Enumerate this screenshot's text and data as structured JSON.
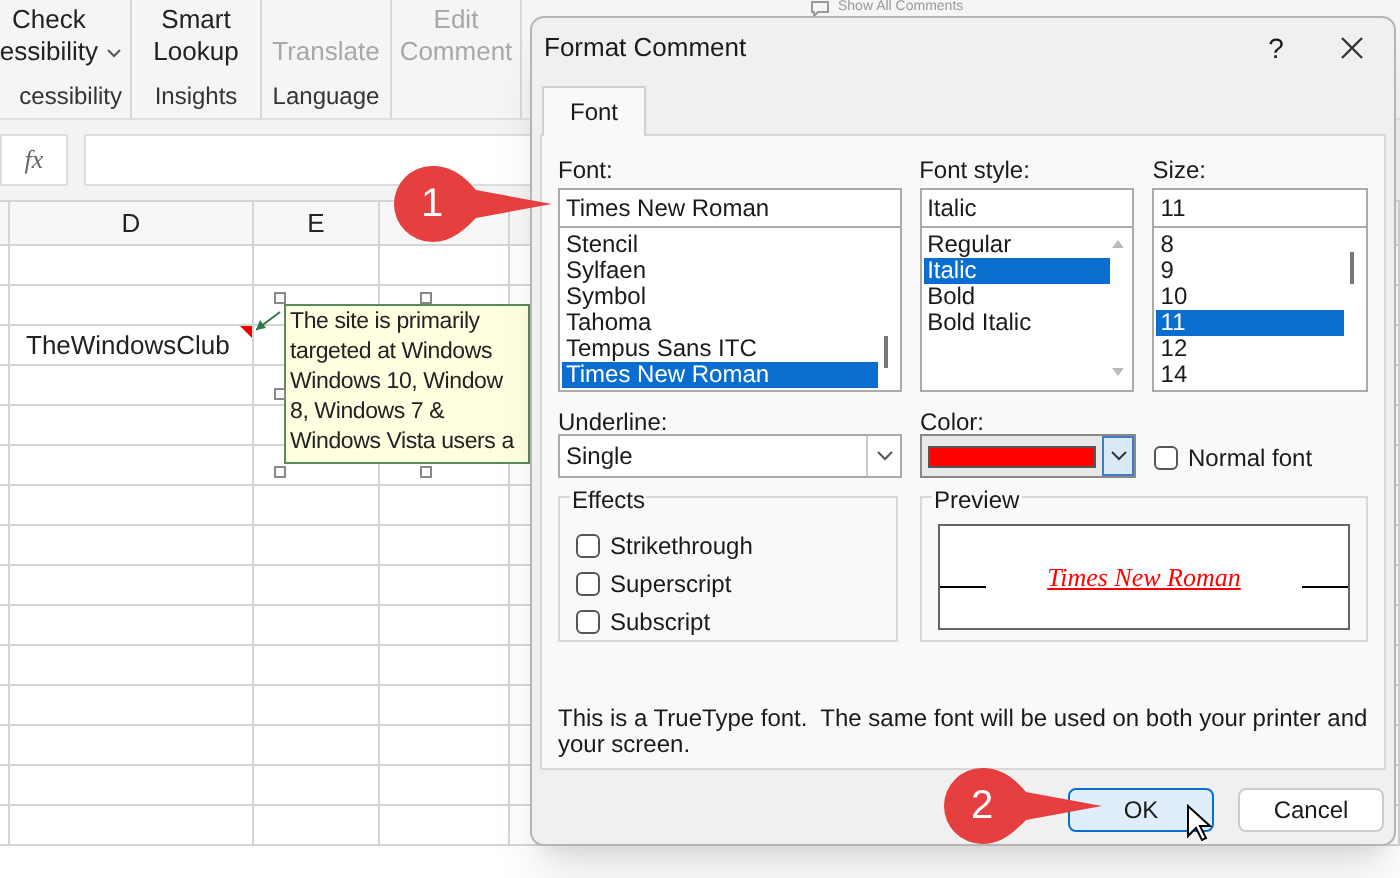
{
  "ribbon": {
    "top_label": "Show All Comments",
    "groups": [
      {
        "button": "Check\nessibility",
        "dropdown": true,
        "label": "cessibility",
        "disabled": false
      },
      {
        "button": "Smart\nLookup",
        "dropdown": false,
        "label": "Insights",
        "disabled": false
      },
      {
        "button": "Translate",
        "dropdown": false,
        "label": "Language",
        "disabled": true
      },
      {
        "button": "Edit\nComment",
        "dropdown": false,
        "disabled": true
      }
    ]
  },
  "formula_bar": {
    "fx": "fx"
  },
  "sheet": {
    "columns": [
      "D",
      "E"
    ],
    "cell_text": "TheWindowsClub",
    "comment": [
      "The site is primarily",
      "targeted at Windows",
      "Windows 10, Window",
      "8, Windows 7 &",
      "Windows Vista users a"
    ]
  },
  "dialog": {
    "title": "Format Comment",
    "help": "?",
    "tabs": [
      {
        "label": "Font",
        "selected": true
      }
    ],
    "font": {
      "label": "Font:",
      "value": "Times New Roman",
      "items": [
        {
          "label": "Stencil",
          "selected": false
        },
        {
          "label": "Sylfaen",
          "selected": false
        },
        {
          "label": "Symbol",
          "selected": false
        },
        {
          "label": "Tahoma",
          "selected": false
        },
        {
          "label": "Tempus Sans ITC",
          "selected": false
        },
        {
          "label": "Times New Roman",
          "selected": true
        }
      ]
    },
    "font_style": {
      "label": "Font style:",
      "value": "Italic",
      "items": [
        {
          "label": "Regular",
          "selected": false
        },
        {
          "label": "Italic",
          "selected": true
        },
        {
          "label": "Bold",
          "selected": false
        },
        {
          "label": "Bold Italic",
          "selected": false
        }
      ]
    },
    "size": {
      "label": "Size:",
      "value": "11",
      "items": [
        {
          "label": "8",
          "selected": false
        },
        {
          "label": "9",
          "selected": false
        },
        {
          "label": "10",
          "selected": false
        },
        {
          "label": "11",
          "selected": true
        },
        {
          "label": "12",
          "selected": false
        },
        {
          "label": "14",
          "selected": false
        }
      ]
    },
    "underline": {
      "label": "Underline:",
      "value": "Single"
    },
    "color": {
      "label": "Color:",
      "color": "#ff0000"
    },
    "normal_font": {
      "label": "Normal font",
      "checked": false
    },
    "effects": {
      "title": "Effects",
      "items": [
        {
          "label": "Strikethrough",
          "checked": false
        },
        {
          "label": "Superscript",
          "checked": false
        },
        {
          "label": "Subscript",
          "checked": false
        }
      ]
    },
    "preview": {
      "title": "Preview",
      "sample": "Times New Roman"
    },
    "note": "This is a TrueType font.  The same font will be used on both your printer and your screen.",
    "buttons": [
      {
        "label": "OK",
        "default": true
      },
      {
        "label": "Cancel",
        "default": false
      }
    ]
  },
  "annotations": [
    {
      "label": "1"
    },
    {
      "label": "2"
    }
  ]
}
